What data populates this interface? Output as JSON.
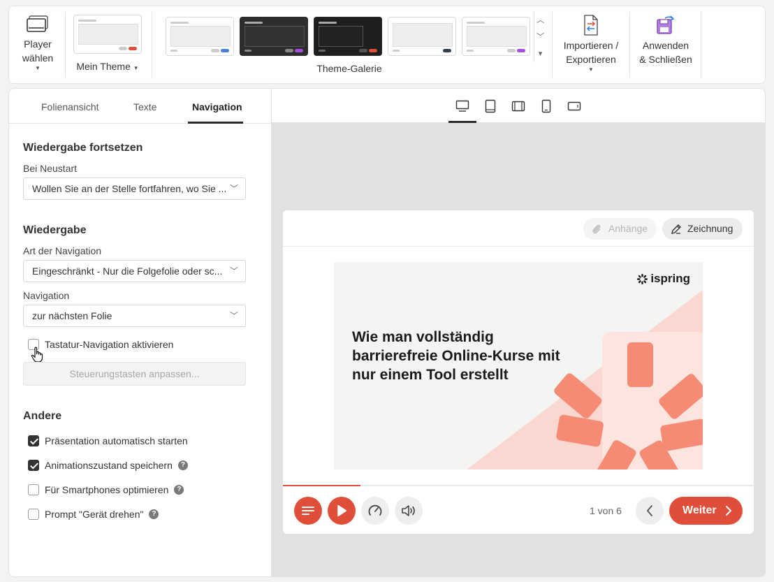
{
  "ribbon": {
    "player_label_1": "Player",
    "player_label_2": "wählen",
    "my_theme_label": "Mein Theme",
    "gallery_label": "Theme-Galerie",
    "import_label_1": "Importieren /",
    "import_label_2": "Exportieren",
    "apply_label_1": "Anwenden",
    "apply_label_2": "& Schließen",
    "theme_accent_colors": [
      "#4a7fd6",
      "#a64ee0",
      "#e04e39",
      "#333d4a",
      "#a64ee0"
    ]
  },
  "panel": {
    "tabs": [
      "Folienansicht",
      "Texte",
      "Navigation"
    ],
    "active_tab": "Navigation",
    "resume": {
      "heading": "Wiedergabe fortsetzen",
      "label": "Bei Neustart",
      "value": "Wollen Sie an der Stelle fortfahren, wo Sie ..."
    },
    "playback": {
      "heading": "Wiedergabe",
      "nav_type_label": "Art der Navigation",
      "nav_type_value": "Eingeschränkt - Nur die Folgefolie oder sc...",
      "nav_label": "Navigation",
      "nav_value": "zur nächsten Folie",
      "keyboard_nav": "Tastatur-Navigation aktivieren",
      "keyboard_nav_checked": false,
      "customize_keys": "Steuerungstasten anpassen..."
    },
    "other": {
      "heading": "Andere",
      "options": [
        {
          "label": "Präsentation automatisch starten",
          "checked": true,
          "help": false
        },
        {
          "label": "Animationszustand speichern",
          "checked": true,
          "help": true
        },
        {
          "label": "Für Smartphones optimieren",
          "checked": false,
          "help": true
        },
        {
          "label": "Prompt \"Gerät drehen\"",
          "checked": false,
          "help": true
        }
      ]
    }
  },
  "preview": {
    "active_device": "desktop",
    "attachments": "Anhänge",
    "drawing": "Zeichnung",
    "slide_title": "Wie man vollständig barrierefreie Online-Kurse mit nur einem Tool erstellt",
    "logo_text": "ispring",
    "counter": "1 von 6",
    "next": "Weiter",
    "progress": 0.165,
    "accent": "#e04e39"
  }
}
